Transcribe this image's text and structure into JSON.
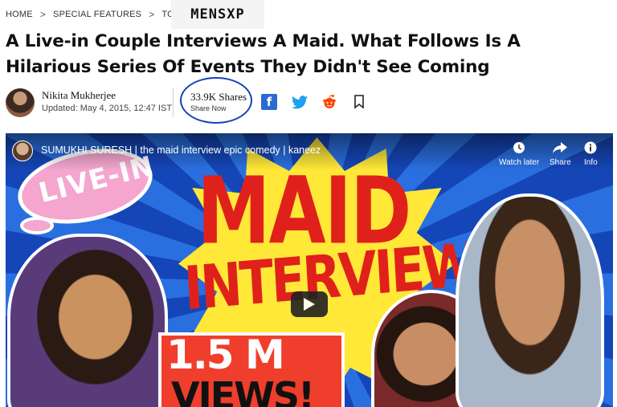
{
  "breadcrumb": {
    "items": [
      "HOME",
      "SPECIAL FEATURES",
      "TODAY"
    ],
    "separator": ">"
  },
  "logo": {
    "text": "MENSXP"
  },
  "article": {
    "headline": "A Live-in Couple Interviews A Maid. What Follows Is A Hilarious Series Of Events They Didn't See Coming",
    "author": "Nikita Mukherjee",
    "updated": "Updated: May 4, 2015, 12:47 IST",
    "shares_count": "33.9K Shares",
    "shares_label": "Share Now"
  },
  "social": {
    "icons": [
      "facebook-icon",
      "twitter-icon",
      "reddit-icon",
      "bookmark-icon"
    ],
    "colors": {
      "facebook": "#2a6bd1",
      "twitter": "#1da1f2",
      "reddit": "#ff4500"
    }
  },
  "video": {
    "title": "SUMUKHI SURESH | the maid interview epic comedy | kaneez",
    "actions": {
      "watch_later": "Watch later",
      "share": "Share",
      "info": "Info"
    },
    "thumbnail": {
      "bubble_text": "LIVE-IN",
      "headline_1": "MAID",
      "headline_2": "INTERVIEW",
      "views_number": "1.5 M",
      "views_word": "VIEWS!"
    }
  }
}
